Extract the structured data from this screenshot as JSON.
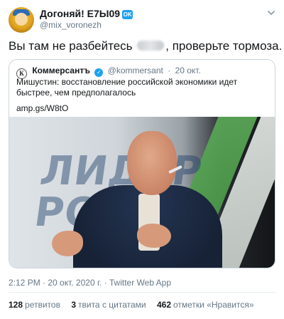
{
  "author": {
    "name": "Догоняй! Е7Ы09",
    "verified_badge": "OK",
    "handle": "@mix_voronezh"
  },
  "tweet": {
    "text_before": "Вы там не разбейтесь",
    "text_after": ", проверьте тормоза."
  },
  "quoted": {
    "avatar_letter": "К",
    "name": "Коммерсантъ",
    "handle": "@kommersant",
    "separator": "·",
    "date": "20 окт.",
    "text": "Мишустин: восстановление российской экономики идет быстрее, чем предполагалось",
    "link": "amp.gs/W8tO",
    "image_text": "ЛИДЕР\nРОСС"
  },
  "meta": {
    "timestamp": "2:12 PM · 20 окт. 2020 г. · Twitter Web App"
  },
  "stats": [
    {
      "count": "128",
      "label": "ретвитов"
    },
    {
      "count": "3",
      "label": "твита с цитатами"
    },
    {
      "count": "462",
      "label": "отметки «Нравится»"
    }
  ],
  "colors": {
    "accent": "#1da1f2",
    "text": "#14171a",
    "muted": "#657786",
    "border": "#ccd6dd"
  }
}
